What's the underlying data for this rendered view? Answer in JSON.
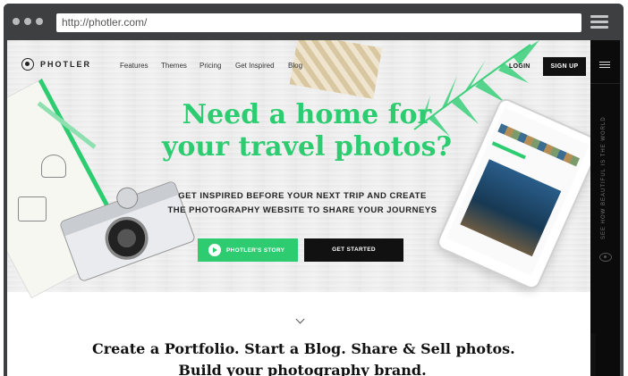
{
  "browser": {
    "url": "http://photler.com/"
  },
  "nav": {
    "logo_text": "PHOTLER",
    "links": [
      "Features",
      "Themes",
      "Pricing",
      "Get Inspired",
      "Blog"
    ],
    "login": "LOGIN",
    "signup": "SIGN UP"
  },
  "hero": {
    "headline_line1": "Need a home for",
    "headline_line2": "your travel photos?",
    "sub_line1": "GET INSPIRED BEFORE YOUR NEXT TRIP AND CREATE",
    "sub_line2": "THE PHOTOGRAPHY WEBSITE TO SHARE YOUR JOURNEYS",
    "story_button": "PHOTLER'S STORY",
    "start_button": "GET STARTED"
  },
  "sidebar": {
    "vertical_text": "SEE HOW BEAUTIFUL IS THE WORLD"
  },
  "section": {
    "tagline_line1": "Create a Portfolio. Start a Blog. Share & Sell photos.",
    "tagline_line2": "Build your photography brand."
  },
  "colors": {
    "accent": "#2ecc71",
    "dark": "#111111"
  },
  "icons": [
    "browser-menu-icon",
    "logo-icon",
    "play-icon",
    "chevron-down-icon",
    "sidebar-menu-icon",
    "eye-icon"
  ]
}
